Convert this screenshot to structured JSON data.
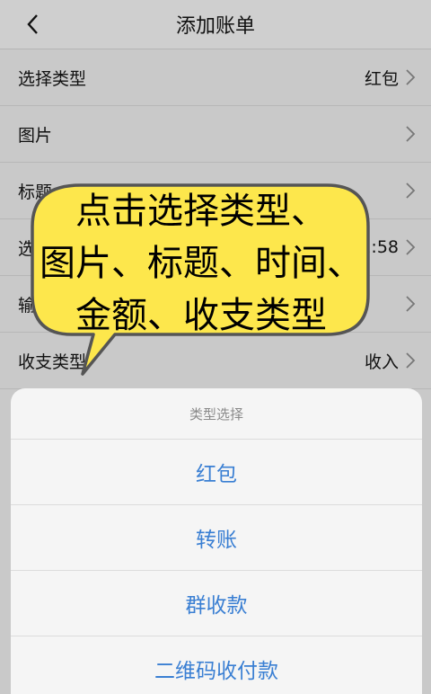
{
  "header": {
    "title": "添加账单",
    "back_icon": "chevron-left-icon"
  },
  "rows": [
    {
      "label": "选择类型",
      "value": "红包"
    },
    {
      "label": "图片",
      "value": ""
    },
    {
      "label": "标题",
      "value": ""
    },
    {
      "label": "选",
      "value": "2:58"
    },
    {
      "label": "输",
      "value": ""
    },
    {
      "label": "收支类型",
      "value": "收入"
    }
  ],
  "callout": {
    "line1": "点击选择类型、",
    "line2": "图片、标题、时间、",
    "line3": "金额、收支类型",
    "fill": "#fde74c",
    "stroke": "#555555"
  },
  "sheet": {
    "title": "类型选择",
    "options": [
      "红包",
      "转账",
      "群收款",
      "二维码收付款"
    ],
    "option_color": "#3a7fd3"
  }
}
